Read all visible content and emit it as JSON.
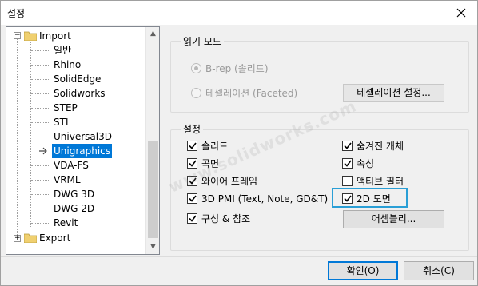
{
  "window": {
    "title": "설정",
    "close_icon": "close-icon"
  },
  "tree": {
    "import_label": "Import",
    "export_label": "Export",
    "items": [
      "일반",
      "Rhino",
      "SolidEdge",
      "Solidworks",
      "STEP",
      "STL",
      "Universal3D",
      "Unigraphics",
      "VDA-FS",
      "VRML",
      "DWG 3D",
      "DWG 2D",
      "Revit"
    ],
    "selected": "Unigraphics",
    "expander_import": "−",
    "expander_export": "+"
  },
  "read_mode": {
    "title": "읽기 모드",
    "option_brep": "B-rep (솔리드)",
    "option_faceted": "테셀레이션 (Faceted)",
    "tess_button": "테셀레이션 설정..."
  },
  "settings": {
    "title": "설정",
    "left": [
      "솔리드",
      "곡면",
      "와이어 프레임",
      "3D PMI (Text, Note, GD&T)",
      "구성 & 참조"
    ],
    "right": [
      "숨겨진 개체",
      "속성",
      "액티브 필터",
      "2D 도면"
    ],
    "assembly_button": "어셈블리..."
  },
  "footer": {
    "ok_label": "확인(O)",
    "cancel_label": "취소(C)"
  },
  "watermark": "www.solidworks.com",
  "colors": {
    "selection": "#0078d7",
    "highlight": "#2a9fd6"
  }
}
